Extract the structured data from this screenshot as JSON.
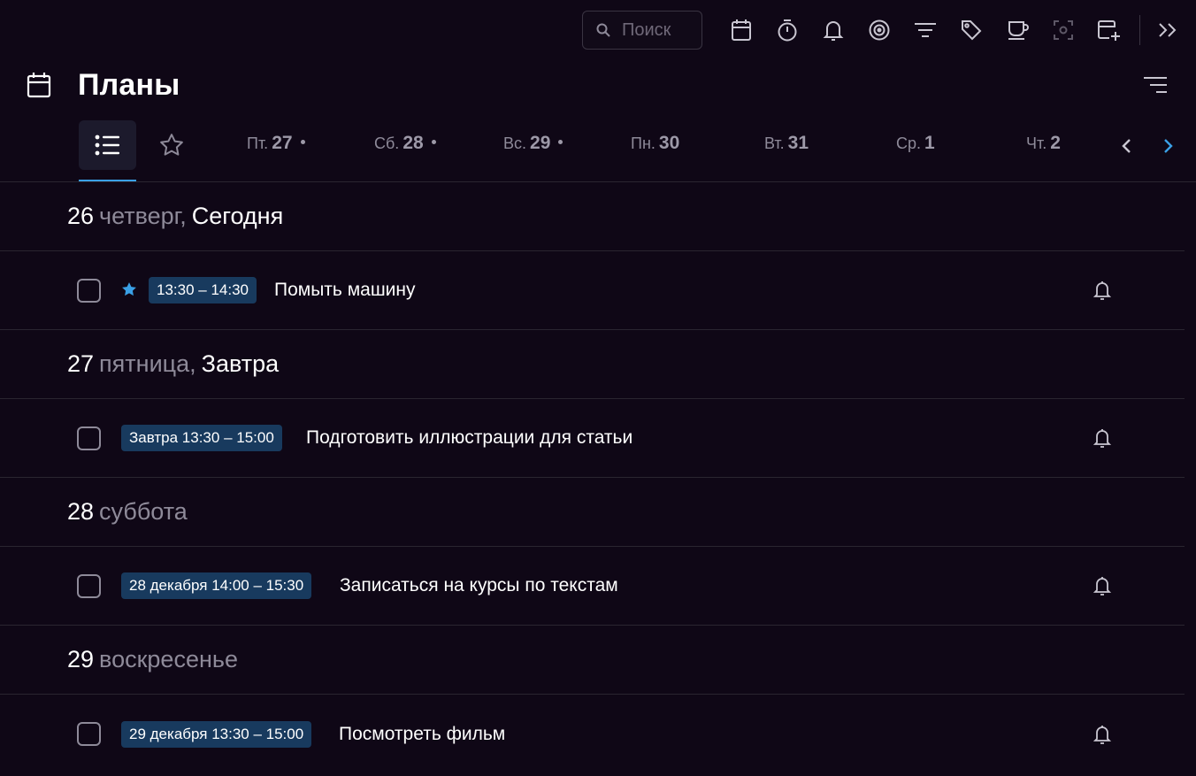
{
  "toolbar": {
    "search": {
      "placeholder": "Поиск",
      "icon": "search-icon"
    },
    "icons": [
      "calendar-icon",
      "timer-icon",
      "bell-icon",
      "focus-target-icon",
      "filter-icon",
      "tag-icon",
      "coffee-cup-icon",
      "screenshot-icon",
      "add-calendar-icon",
      "collapse-double-chevron-icon"
    ]
  },
  "header": {
    "title": "Планы",
    "icon": "calendar-icon"
  },
  "tabs": {
    "days": [
      {
        "name": "Пт.",
        "num": "27",
        "dot": true
      },
      {
        "name": "Сб.",
        "num": "28",
        "dot": true
      },
      {
        "name": "Вс.",
        "num": "29",
        "dot": true
      },
      {
        "name": "Пн.",
        "num": "30",
        "dot": false
      },
      {
        "name": "Вт.",
        "num": "31",
        "dot": false
      },
      {
        "name": "Ср.",
        "num": "1",
        "dot": false
      },
      {
        "name": "Чт.",
        "num": "2",
        "dot": false
      }
    ]
  },
  "days": [
    {
      "num": "26",
      "weekday": "четверг,",
      "relative": "Сегодня",
      "task": {
        "starred": true,
        "time": "13:30 – 14:30",
        "title": "Помыть машину"
      }
    },
    {
      "num": "27",
      "weekday": "пятница,",
      "relative": "Завтра",
      "task": {
        "starred": false,
        "time": "Завтра 13:30 – 15:00",
        "title": "Подготовить иллюстрации для статьи"
      }
    },
    {
      "num": "28",
      "weekday": "суббота",
      "relative": "",
      "task": {
        "starred": false,
        "time": "28 декабря 14:00 – 15:30",
        "title": "Записаться на курсы по текстам"
      }
    },
    {
      "num": "29",
      "weekday": "воскресенье",
      "relative": "",
      "task": {
        "starred": false,
        "time": "29 декабря 13:30 – 15:00",
        "title": "Посмотреть фильм"
      }
    }
  ],
  "colors": {
    "background": "#0f0716",
    "accent": "#3aa0e6",
    "badge": "#183a5e",
    "muted": "#8e8a99"
  }
}
